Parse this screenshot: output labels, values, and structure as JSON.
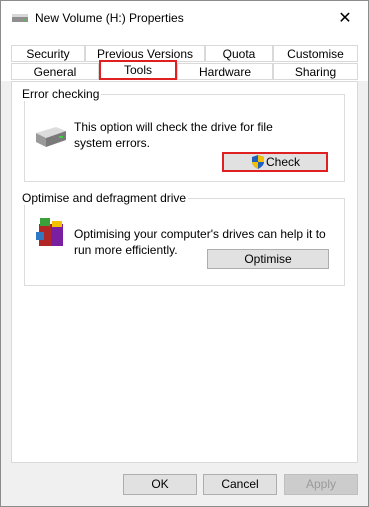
{
  "window": {
    "title": "New Volume (H:) Properties",
    "close_symbol": "✕"
  },
  "tabs": {
    "row1": [
      "Security",
      "Previous Versions",
      "Quota",
      "Customise"
    ],
    "row2": [
      "General",
      "Tools",
      "Hardware",
      "Sharing"
    ],
    "active": "Tools"
  },
  "error_checking": {
    "title": "Error checking",
    "description": "This option will check the drive for file system errors.",
    "button_label": "Check",
    "icon": "drive-icon"
  },
  "optimise": {
    "title": "Optimise and defragment drive",
    "description": "Optimising your computer's drives can help it to run more efficiently.",
    "button_label": "Optimise",
    "icon": "defrag-icon"
  },
  "footer": {
    "ok_label": "OK",
    "cancel_label": "Cancel",
    "apply_label": "Apply"
  },
  "colors": {
    "highlight": "#e02020",
    "shield_blue": "#1f5fbf",
    "shield_yellow": "#f2c200"
  }
}
